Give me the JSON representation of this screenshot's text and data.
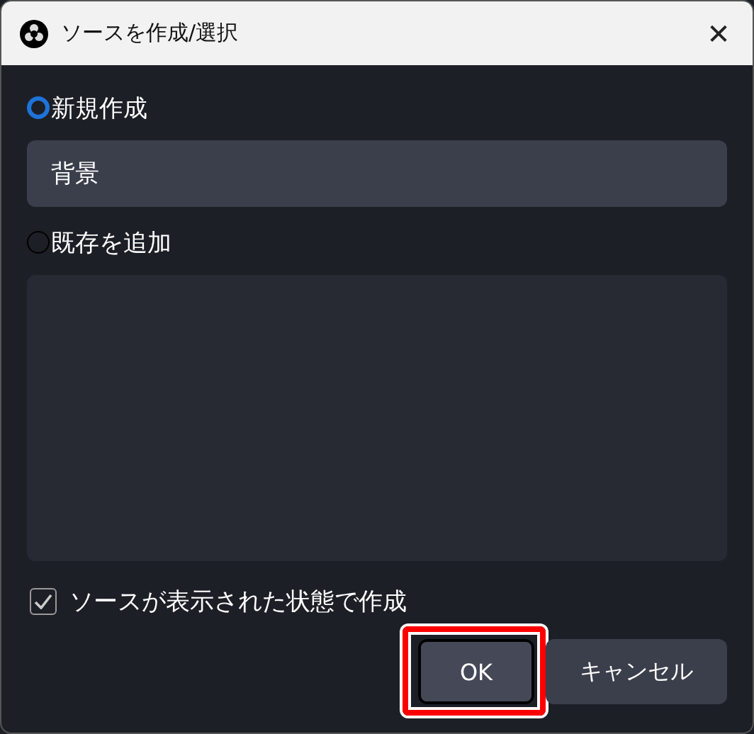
{
  "window": {
    "title": "ソースを作成/選択",
    "close": "✕"
  },
  "options": [
    {
      "kind": "radio",
      "label": "新規作成",
      "selected": true
    },
    {
      "kind": "field",
      "value": "背景"
    },
    {
      "kind": "radio",
      "label": "既存を追加",
      "selected": false
    },
    {
      "kind": "list"
    }
  ],
  "visible_checkbox": {
    "label": "ソースが表示された状態で作成",
    "checked": true
  },
  "buttons": [
    {
      "label": "OK",
      "focused": true,
      "highlighted": true
    },
    {
      "label": "キャンセル",
      "focused": false,
      "highlighted": false
    }
  ]
}
